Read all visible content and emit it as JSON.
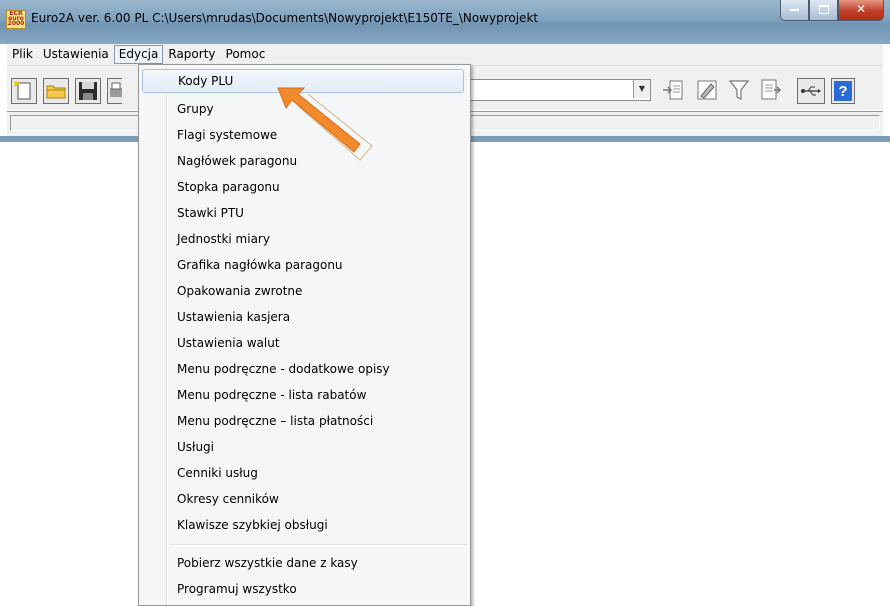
{
  "window": {
    "title": "Euro2A ver. 6.00 PL   C:\\Users\\mrudas\\Documents\\Nowyprojekt\\E150TE_\\Nowyprojekt",
    "logo_lines": [
      "ECR",
      "euro",
      "2000"
    ]
  },
  "menu_bar": [
    "Plik",
    "Ustawienia",
    "Edycja",
    "Raporty",
    "Pomoc"
  ],
  "menu_active": "Edycja",
  "dropdown": {
    "items": [
      "Kody PLU",
      "Grupy",
      "Flagi systemowe",
      "Nagłówek paragonu",
      "Stopka paragonu",
      "Stawki PTU",
      "Jednostki miary",
      "Grafika nagłówka paragonu",
      "Opakowania zwrotne",
      "Ustawienia kasjera",
      "Ustawienia walut",
      "Menu podręczne - dodatkowe opisy",
      "Menu podręczne - lista rabatów",
      "Menu podręczne – lista płatności",
      "Usługi",
      "Cenniki usług",
      "Okresy cenników",
      "Klawisze szybkiej obsługi"
    ],
    "items_after_separator": [
      "Pobierz wszystkie dane z kasy",
      "Programuj wszystko"
    ],
    "highlighted": "Kody PLU"
  },
  "toolbar": {
    "left_icons": [
      "new-file-icon",
      "open-folder-icon",
      "save-icon",
      "print-icon"
    ],
    "right_icons": [
      "import-icon",
      "edit-tool-icon",
      "filter-icon",
      "report-icon",
      "usb-icon",
      "help-icon"
    ]
  },
  "colors": {
    "arrow": "#f28a2e",
    "highlight_border": "#a9c3e3",
    "title_bar": "#7fa2bf",
    "close_button": "#c0402a"
  }
}
